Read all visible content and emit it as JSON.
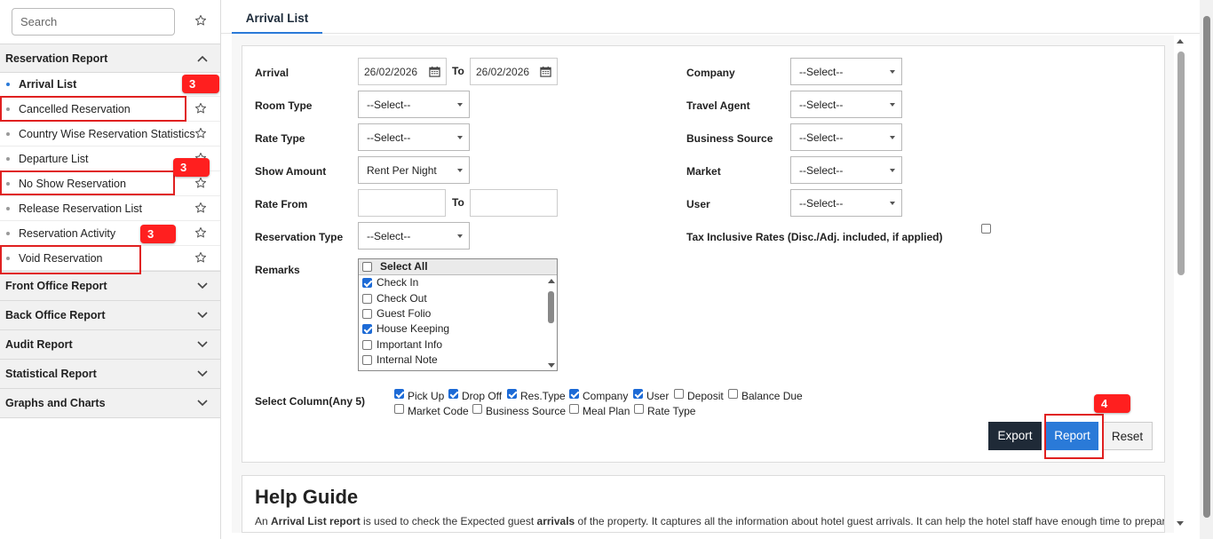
{
  "sidebar": {
    "search_placeholder": "Search",
    "reservation_report": {
      "title": "Reservation Report",
      "items": [
        {
          "label": "Arrival List"
        },
        {
          "label": "Cancelled Reservation"
        },
        {
          "label": "Country Wise Reservation Statistics"
        },
        {
          "label": "Departure List"
        },
        {
          "label": "No Show Reservation"
        },
        {
          "label": "Release Reservation List"
        },
        {
          "label": "Reservation Activity"
        },
        {
          "label": "Void Reservation"
        }
      ]
    },
    "sections": [
      {
        "label": "Front Office Report"
      },
      {
        "label": "Back Office Report"
      },
      {
        "label": "Audit Report"
      },
      {
        "label": "Statistical Report"
      },
      {
        "label": "Graphs and Charts"
      }
    ]
  },
  "annotations": {
    "badge_1": "3",
    "badge_2": "3",
    "badge_3": "3",
    "badge_4": "4"
  },
  "tab": {
    "label": "Arrival List"
  },
  "form": {
    "arrival": {
      "label": "Arrival",
      "from": "26/02/2026",
      "to_label": "To",
      "to": "26/02/2026"
    },
    "room_type": {
      "label": "Room Type",
      "value": "--Select--"
    },
    "rate_type": {
      "label": "Rate Type",
      "value": "--Select--"
    },
    "show_amount": {
      "label": "Show Amount",
      "value": "Rent Per Night"
    },
    "rate_from": {
      "label": "Rate From",
      "to_label": "To",
      "from": "",
      "to": ""
    },
    "reservation_type": {
      "label": "Reservation Type",
      "value": "--Select--"
    },
    "remarks": {
      "label": "Remarks",
      "select_all": "Select All",
      "options": [
        {
          "label": "Check In",
          "checked": true
        },
        {
          "label": "Check Out",
          "checked": false
        },
        {
          "label": "Guest Folio",
          "checked": false
        },
        {
          "label": "House Keeping",
          "checked": true
        },
        {
          "label": "Important Info",
          "checked": false
        },
        {
          "label": "Internal Note",
          "checked": false
        }
      ]
    },
    "company": {
      "label": "Company",
      "value": "--Select--"
    },
    "travel_agent": {
      "label": "Travel Agent",
      "value": "--Select--"
    },
    "business_source": {
      "label": "Business Source",
      "value": "--Select--"
    },
    "market": {
      "label": "Market",
      "value": "--Select--"
    },
    "user": {
      "label": "User",
      "value": "--Select--"
    },
    "tax_inclusive": {
      "label": "Tax Inclusive Rates (Disc./Adj. included, if applied)",
      "checked": false
    },
    "select_column": {
      "label": "Select Column(Any 5)",
      "columns": [
        {
          "label": "Pick Up",
          "checked": true
        },
        {
          "label": "Drop Off",
          "checked": true
        },
        {
          "label": "Res.Type",
          "checked": true
        },
        {
          "label": "Company",
          "checked": true
        },
        {
          "label": "User",
          "checked": true
        },
        {
          "label": "Deposit",
          "checked": false
        },
        {
          "label": "Balance Due",
          "checked": false
        },
        {
          "label": "Market Code",
          "checked": false
        },
        {
          "label": "Business Source",
          "checked": false
        },
        {
          "label": "Meal Plan",
          "checked": false
        },
        {
          "label": "Rate Type",
          "checked": false
        }
      ]
    }
  },
  "buttons": {
    "export": "Export",
    "report": "Report",
    "reset": "Reset"
  },
  "help": {
    "title": "Help Guide",
    "text_1": "An ",
    "text_2": "Arrival List report",
    "text_3": " is used to check the Expected guest ",
    "text_4": "arrivals",
    "text_5": " of the property. It captures all the information about hotel guest arrivals. It can help the hotel staff have enough time to prepare"
  },
  "colors": {
    "accent": "#2a7ad8",
    "annotation": "#ff1f1f",
    "export_button": "#1f2a37"
  }
}
